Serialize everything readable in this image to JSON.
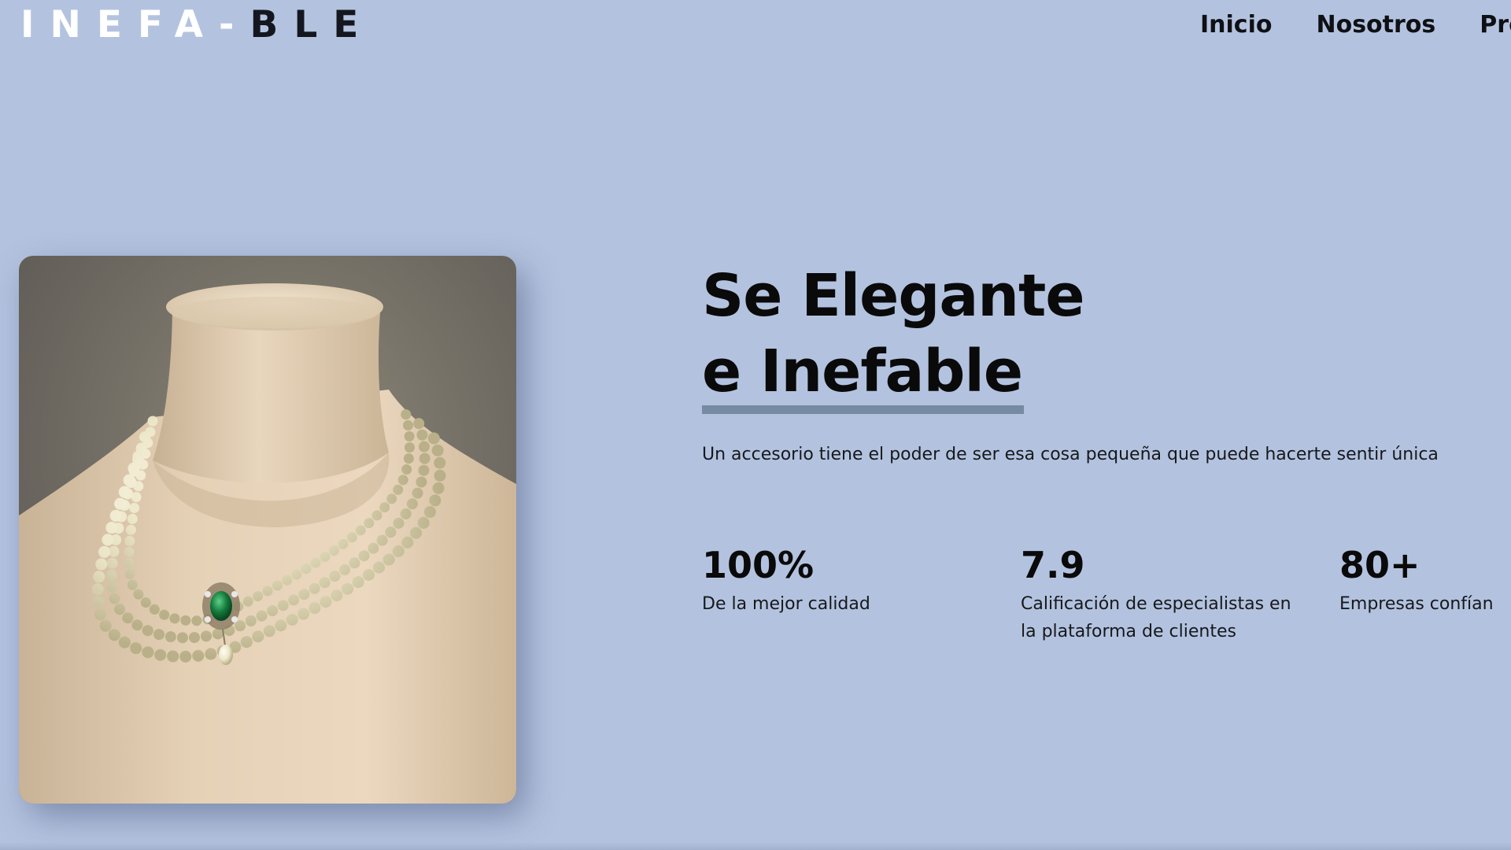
{
  "header": {
    "logo": {
      "text_light": "INEFA-",
      "text_dark": "BLE"
    },
    "nav": [
      {
        "label": "Inicio"
      },
      {
        "label": "Nosotros"
      },
      {
        "label": "Pro"
      }
    ]
  },
  "hero": {
    "image_alt_name": "pearl-necklace-photo",
    "title_line1": "Se Elegante",
    "title_line2": "e Inefable",
    "tagline": "Un accesorio tiene el poder de ser esa cosa pequeña que puede hacerte sentir única"
  },
  "stats": [
    {
      "value": "100%",
      "label": "De la mejor calidad"
    },
    {
      "value": "7.9",
      "label": "Calificación de especialistas en la plataforma de clientes"
    },
    {
      "value": "80+",
      "label": "Empresas confían"
    }
  ],
  "colors": {
    "background": "#b3c3df",
    "underline": "#768aa3",
    "logo_light": "#ffffff",
    "logo_dark": "#14171f"
  }
}
